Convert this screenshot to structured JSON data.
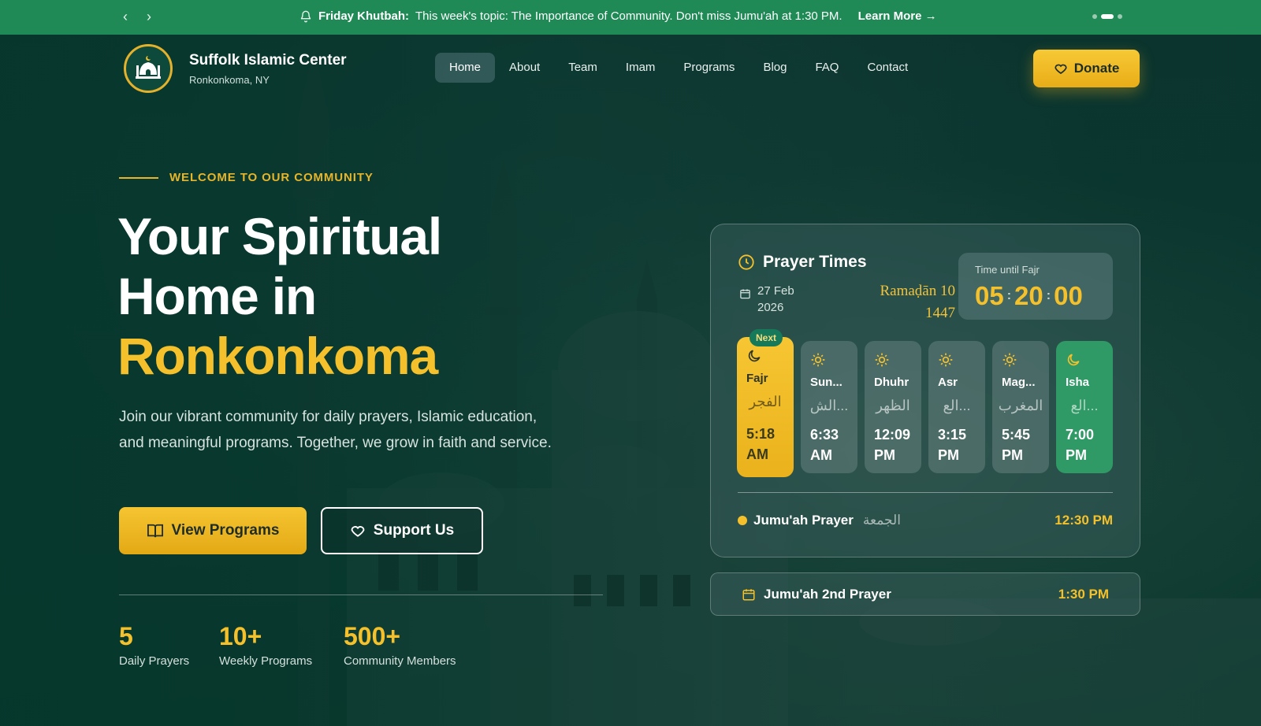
{
  "announcement": {
    "prev_icon": "chevron-left-icon",
    "next_icon": "chevron-right-icon",
    "bell_icon": "bell-icon",
    "label": "Friday Khutbah:",
    "text": "This week's topic: The Importance of Community. Don't miss Jumu'ah at 1:30 PM.",
    "link": "Learn More →"
  },
  "header": {
    "brand_name": "Suffolk Islamic Center",
    "brand_location": "Ronkonkoma, NY",
    "nav": [
      "Home",
      "About",
      "Team",
      "Imam",
      "Programs",
      "Blog",
      "FAQ",
      "Contact"
    ],
    "active_nav": "Home",
    "donate_label": "Donate"
  },
  "hero": {
    "eyebrow": "WELCOME TO OUR COMMUNITY",
    "title_line1": "Your Spiritual",
    "title_line2": "Home in",
    "title_highlight": "Ronkonkoma",
    "lead": "Join our vibrant community for daily prayers, Islamic education, and meaningful programs. Together, we grow in faith and service.",
    "primary_button": "View Programs",
    "secondary_button": "Support Us",
    "stats": [
      {
        "value": "5",
        "label": "Daily Prayers"
      },
      {
        "value": "10+",
        "label": "Weekly Programs"
      },
      {
        "value": "500+",
        "label": "Community Members"
      }
    ]
  },
  "prayer_card": {
    "title": "Prayer Times",
    "date_line1": "27 Feb",
    "date_line2": "2026",
    "hijri_line1": "Ramaḍān 10",
    "hijri_line2": "1447",
    "countdown_label": "Time until Fajr",
    "countdown": {
      "hours": "05",
      "minutes": "20",
      "seconds": "00",
      "separator": ":"
    },
    "next_badge": "Next",
    "prayers": [
      {
        "name": "Fajr",
        "arabic": "الفجر",
        "time_line1": "5:18",
        "time_line2": "AM",
        "icon": "moon-icon"
      },
      {
        "name": "Sun...",
        "arabic": "الش...",
        "time_line1": "6:33",
        "time_line2": "AM",
        "icon": "sun-icon"
      },
      {
        "name": "Dhuhr",
        "arabic": "الظهر",
        "time_line1": "12:09",
        "time_line2": "PM",
        "icon": "sun-icon"
      },
      {
        "name": "Asr",
        "arabic": "الع...",
        "time_line1": "3:15",
        "time_line2": "PM",
        "icon": "sun-icon"
      },
      {
        "name": "Mag...",
        "arabic": "المغرب",
        "time_line1": "5:45",
        "time_line2": "PM",
        "icon": "sun-icon"
      },
      {
        "name": "Isha",
        "arabic": "الع...",
        "time_line1": "7:00",
        "time_line2": "PM",
        "icon": "moon-icon"
      }
    ],
    "jumuah": {
      "name": "Jumu'ah Prayer",
      "arabic": "الجمعة",
      "time": "12:30 PM"
    }
  },
  "second_jumuah": {
    "name": "Jumu'ah 2nd Prayer",
    "time": "1:30 PM"
  },
  "colors": {
    "accent": "#f4c12c",
    "topbar": "#1f8a55",
    "isha": "#2f9a66"
  }
}
